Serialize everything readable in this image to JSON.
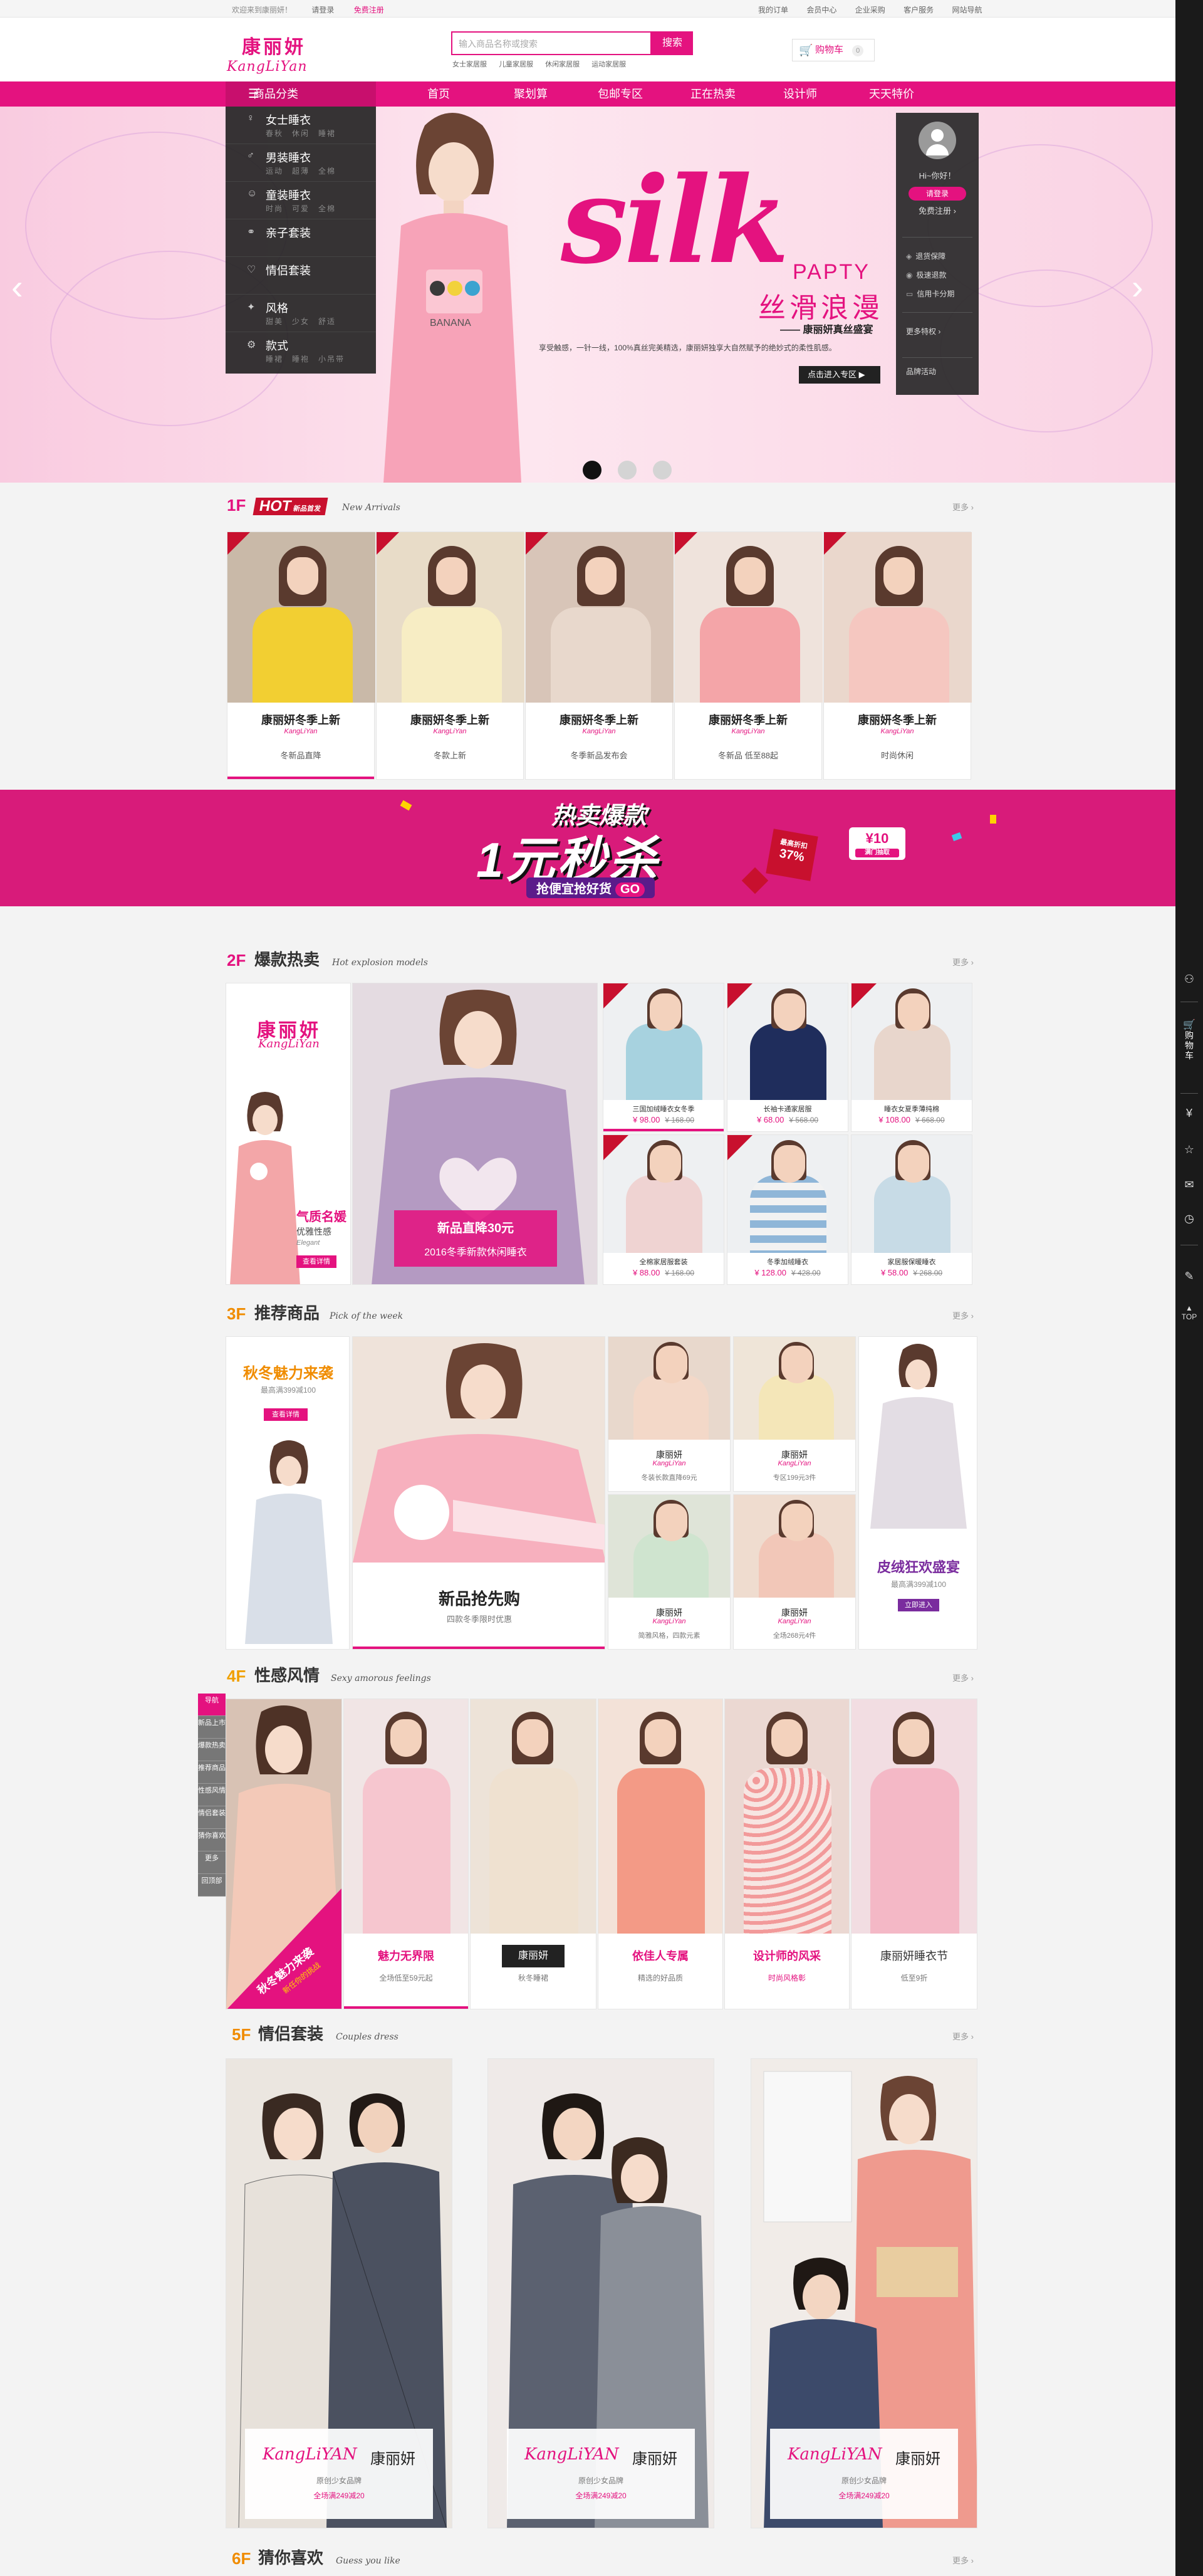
{
  "topbar": {
    "welcome": "欢迎来到康丽妍！",
    "login": "请登录",
    "register": "免费注册",
    "right": [
      "我的订单",
      "会员中心",
      "企业采购",
      "客户服务",
      "网站导航"
    ]
  },
  "header": {
    "logo_cn": "康丽妍",
    "logo_en": "KangLiYan",
    "search_placeholder": "输入商品名称或搜索",
    "search_button": "搜索",
    "hot_words": [
      "女士家居服",
      "儿童家居服",
      "休闲家居服",
      "运动家居服"
    ],
    "cart_label": "购物车",
    "cart_count": "0"
  },
  "nav": {
    "category_head": "商品分类",
    "items": [
      "首页",
      "聚划算",
      "包邮专区",
      "正在热卖",
      "设计师",
      "天天特价"
    ]
  },
  "categories": [
    {
      "title": "女士睡衣",
      "subs": [
        "春秋",
        "休闲",
        "睡裙"
      ]
    },
    {
      "title": "男装睡衣",
      "subs": [
        "运动",
        "超薄",
        "全棉"
      ]
    },
    {
      "title": "童装睡衣",
      "subs": [
        "时尚",
        "可爱",
        "全棉"
      ]
    },
    {
      "title": "亲子套装",
      "subs": []
    },
    {
      "title": "情侣套装",
      "subs": []
    },
    {
      "title": "风格",
      "subs": [
        "甜美",
        "少女",
        "舒适"
      ]
    },
    {
      "title": "款式",
      "subs": [
        "睡裙",
        "睡袍",
        "小吊带"
      ]
    }
  ],
  "banner": {
    "headline": "silk",
    "party": "PAPTY",
    "cn_title": "丝滑浪漫",
    "sub": "—— 康丽妍真丝盛宴",
    "desc": "享受触感，一针一线，100%真丝完美精选，康丽妍独享大自然赋予的绝妙式的柔性肌感。",
    "enter": "点击进入专区 ▶",
    "dots": 3,
    "active_dot": 0
  },
  "user_card": {
    "greeting": "Hi~你好！",
    "login": "请登录",
    "register": "免费注册 ›",
    "guarantees": [
      "退货保障",
      "极速退款",
      "信用卡分期"
    ],
    "more": "更多特权 ›",
    "brand": "品牌活动"
  },
  "floors": {
    "f1": {
      "num": "1F",
      "tag": "HOT",
      "tag_sub": "新品首发",
      "en": "New Arrivals",
      "more": "更多 ›"
    },
    "f2": {
      "num": "2F",
      "title": "爆款热卖",
      "en": "Hot explosion models",
      "more": "更多 ›"
    },
    "f3": {
      "num": "3F",
      "title": "推荐商品",
      "en": "Pick of the week",
      "more": "更多 ›"
    },
    "f4": {
      "num": "4F",
      "title": "性感风情",
      "en": "Sexy amorous feelings",
      "more": "更多 ›"
    },
    "f5": {
      "num": "5F",
      "title": "情侣套装",
      "en": "Couples dress",
      "more": "更多 ›"
    },
    "f6": {
      "num": "6F",
      "title": "猜你喜欢",
      "en": "Guess you like",
      "more": "更多 ›"
    }
  },
  "f1_products": [
    {
      "name": "康丽妍冬季上新",
      "brand": "KangLiYan",
      "sub": "冬新品直降"
    },
    {
      "name": "康丽妍冬季上新",
      "brand": "KangLiYan",
      "sub": "冬款上新"
    },
    {
      "name": "康丽妍冬季上新",
      "brand": "KangLiYan",
      "sub": "冬季新品发布会"
    },
    {
      "name": "康丽妍冬季上新",
      "brand": "KangLiYan",
      "sub": "冬新品  低至88起"
    },
    {
      "name": "康丽妍冬季上新",
      "brand": "KangLiYan",
      "sub": "时尚休闲"
    }
  ],
  "sale": {
    "top": "热卖爆款",
    "main": "1元秒杀",
    "bottom": "抢便宜抢好货",
    "go": "GO",
    "pct_label": "最高折扣",
    "pct": "37%",
    "coupon": "¥10",
    "coupon_sub": "满门抽取"
  },
  "f2": {
    "brand_cn": "康丽妍",
    "brand_en": "KangLiYan",
    "lady": "气质名媛",
    "lady_sub": "优雅性感",
    "lady_en": "Elegant",
    "lady_btn": "查看详情",
    "promo_title": "新品直降30元",
    "promo_sub": "2016冬季新款休闲睡衣",
    "items": [
      {
        "name": "三国加绒睡衣女冬季",
        "price": "¥ 98.00",
        "old": "¥ 168.00"
      },
      {
        "name": "长袖卡通家居服",
        "price": "¥ 68.00",
        "old": "¥ 568.00"
      },
      {
        "name": "睡衣女夏季薄纯棉",
        "price": "¥ 108.00",
        "old": "¥ 668.00"
      },
      {
        "name": "全棉家居服套装",
        "price": "¥ 88.00",
        "old": "¥ 168.00"
      },
      {
        "name": "冬季加绒睡衣",
        "price": "¥ 128.00",
        "old": "¥ 428.00"
      },
      {
        "name": "家居服保暖睡衣",
        "price": "¥ 58.00",
        "old": "¥ 268.00"
      }
    ]
  },
  "f3": {
    "left_title": "秋冬魅力来袭",
    "left_sub": "最高满399减100",
    "left_btn": "查看详情",
    "center_title": "新品抢先购",
    "center_sub": "四款冬季限时优惠",
    "items": [
      {
        "brand": "康丽妍",
        "en": "KangLiYan",
        "sub": "冬装长款直降69元"
      },
      {
        "brand": "康丽妍",
        "en": "KangLiYan",
        "sub": "专区199元3件"
      },
      {
        "brand": "康丽妍",
        "en": "KangLiYan",
        "sub": "简雅风格，四款元素"
      },
      {
        "brand": "康丽妍",
        "en": "KangLiYan",
        "sub": "全场268元4件"
      }
    ],
    "right_title": "皮绒狂欢盛宴",
    "right_sub": "最高满399减100",
    "right_btn": "立即进入"
  },
  "f4": {
    "nav": [
      "导航",
      "新品上市",
      "爆款热卖",
      "推荐商品",
      "性感风情",
      "情侣套装",
      "猜你喜欢",
      "更多",
      "回顶部"
    ],
    "promo": "秋冬魅力来袭",
    "promo_sub": "新任你的挑战",
    "items": [
      {
        "title": "魅力无界限",
        "sub": "全场低至59元起"
      },
      {
        "title": "康丽妍",
        "sub": "秋冬睡裙"
      },
      {
        "title": "依佳人专属",
        "sub": "精选的好品质"
      },
      {
        "title": "设计师的风采",
        "sub": "时尚风格彰"
      },
      {
        "title": "康丽妍睡衣节",
        "sub": "低至9折"
      }
    ]
  },
  "f5": {
    "items": [
      {
        "en": "KangLiYAN",
        "cn": "康丽妍",
        "sub": "原创少女品牌",
        "promo": "全场满249减20"
      },
      {
        "en": "KangLiYAN",
        "cn": "康丽妍",
        "sub": "原创少女品牌",
        "promo": "全场满249减20"
      },
      {
        "en": "KangLiYAN",
        "cn": "康丽妍",
        "sub": "原创少女品牌",
        "promo": "全场满249减20"
      }
    ]
  },
  "right_toolbar": {
    "cart": "购物车",
    "top": "TOP"
  },
  "colors": {
    "brand": "#e4127f",
    "dark": "#222222",
    "bg": "#f3f3f3"
  }
}
